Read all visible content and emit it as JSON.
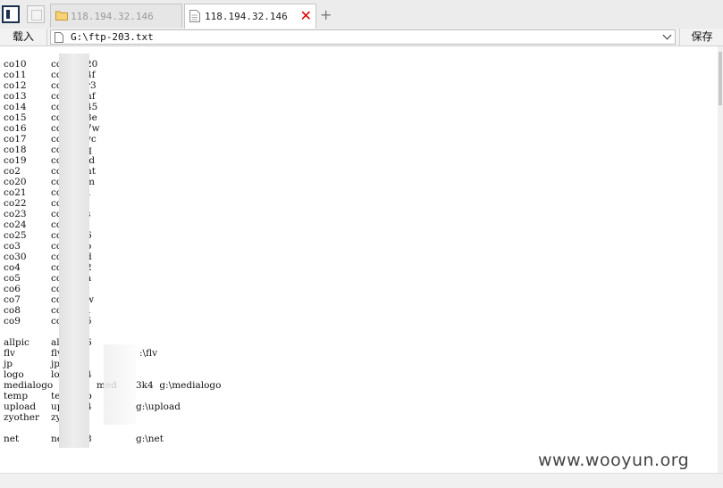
{
  "tabs": [
    {
      "label": "118.194.32.146",
      "active": false
    },
    {
      "label": "118.194.32.146",
      "active": true
    }
  ],
  "toolbar": {
    "load_label": "载入",
    "path": "G:\\ftp-203.txt",
    "save_label": "保存"
  },
  "lines": [
    {
      "c1": "co10",
      "c2": "co",
      "c2b": "20",
      "c3": ""
    },
    {
      "c1": "co11",
      "c2": "co",
      "c2b": "4f",
      "c3": ""
    },
    {
      "c1": "co12",
      "c2": "co",
      "c2b": "r3",
      "c3": ""
    },
    {
      "c1": "co13",
      "c2": "co",
      "c2b": "nf",
      "c3": ""
    },
    {
      "c1": "co14",
      "c2": "co",
      "c2b": "45",
      "c3": ""
    },
    {
      "c1": "co15",
      "c2": "co",
      "c2b": "3e",
      "c3": ""
    },
    {
      "c1": "co16",
      "c2": "co",
      "c2b": "7w",
      "c3": ""
    },
    {
      "c1": "co17",
      "c2": "co",
      "c2b": "vc",
      "c3": ""
    },
    {
      "c1": "co18",
      "c2": "co",
      "c2b": "q",
      "c3": ""
    },
    {
      "c1": "co19",
      "c2": "co",
      "c2b": "id",
      "c3": ""
    },
    {
      "c1": "co2",
      "c2": "co",
      "c2b": "nt",
      "c3": ""
    },
    {
      "c1": "co20",
      "c2": "co2",
      "c2b": "m",
      "c3": ""
    },
    {
      "c1": "co21",
      "c2": "co2",
      "c2b": "1",
      "c3": ""
    },
    {
      "c1": "co22",
      "c2": "co2",
      "c2b": "j",
      "c3": ""
    },
    {
      "c1": "co23",
      "c2": "co2",
      "c2b": "s",
      "c3": ""
    },
    {
      "c1": "co24",
      "c2": "co2",
      "c2b": "l",
      "c3": ""
    },
    {
      "c1": "co25",
      "c2": "co2",
      "c2b": "6",
      "c3": ""
    },
    {
      "c1": "co3",
      "c2": "co3",
      "c2b": "o",
      "c3": ""
    },
    {
      "c1": "co30",
      "c2": "co3",
      "c2b": "d",
      "c3": ""
    },
    {
      "c1": "co4",
      "c2": "co4",
      "c2b": "2",
      "c3": ""
    },
    {
      "c1": "co5",
      "c2": "co5",
      "c2b": "a",
      "c3": ""
    },
    {
      "c1": "co6",
      "c2": "co6",
      "c2b": "l",
      "c3": ""
    },
    {
      "c1": "co7",
      "c2": "co7",
      "c2b": "w",
      "c3": ""
    },
    {
      "c1": "co8",
      "c2": "co8",
      "c2b": "1",
      "c3": ""
    },
    {
      "c1": "co9",
      "c2": "co9",
      "c2b": "5",
      "c3": ""
    },
    {
      "c1": "",
      "c2": "",
      "c2b": "",
      "c3": ""
    },
    {
      "c1": "allpic",
      "c2": "all",
      "c2b": "6",
      "c3": ""
    },
    {
      "c1": "flv",
      "c2": "flv",
      "c2b": "",
      "c3": ":\\flv"
    },
    {
      "c1": "jp",
      "c2": "jp3",
      "c2b": "",
      "c3": ""
    },
    {
      "c1": "logo",
      "c2": "log",
      "c2b": "4",
      "c3": ""
    },
    {
      "c1": "medialogo",
      "c2": "",
      "c2b": "med",
      "c3": "3k4  g:\\medialogo"
    },
    {
      "c1": "temp",
      "c2": "tem",
      "c2b": "p",
      "c3": ""
    },
    {
      "c1": "upload",
      "c2": "upl",
      "c2b": "4",
      "c3": "g:\\upload"
    },
    {
      "c1": "zyother",
      "c2": "zyo",
      "c2b": "j",
      "c3": ""
    },
    {
      "c1": "",
      "c2": "",
      "c2b": "",
      "c3": ""
    },
    {
      "c1": "net",
      "c2": "net",
      "c2b": "8",
      "c3": "g:\\net"
    }
  ],
  "watermark": "www.wooyun.org"
}
